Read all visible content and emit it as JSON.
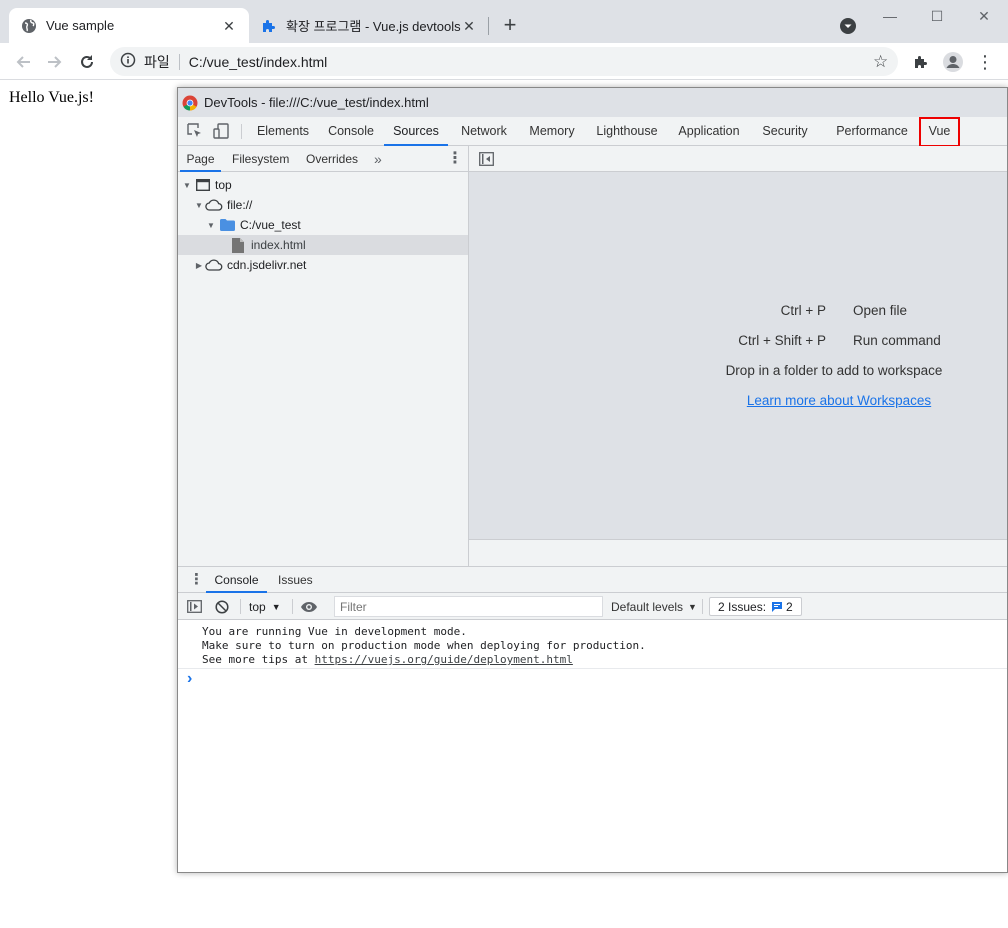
{
  "browser": {
    "tabs": [
      {
        "title": "Vue sample",
        "active": true,
        "icon": "globe-icon"
      },
      {
        "title": "확장 프로그램 - Vue.js devtools",
        "active": false,
        "icon": "puzzle-icon"
      }
    ],
    "new_tab": "+",
    "omnibox": {
      "protocol_label": "파일",
      "url": "C:/vue_test/index.html"
    }
  },
  "page": {
    "body_text": "Hello Vue.js!"
  },
  "devtools": {
    "title": "DevTools - file:///C:/vue_test/index.html",
    "tabs": [
      "Elements",
      "Console",
      "Sources",
      "Network",
      "Memory",
      "Lighthouse",
      "Application",
      "Security",
      "Performance",
      "Vue"
    ],
    "selected_tab": "Sources",
    "highlighted_tab": "Vue",
    "sources": {
      "subtabs": [
        "Page",
        "Filesystem",
        "Overrides"
      ],
      "more": "»",
      "tree": [
        {
          "label": "top",
          "icon": "frame-icon"
        },
        {
          "label": "file://",
          "icon": "cloud-icon"
        },
        {
          "label": "C:/vue_test",
          "icon": "folder-icon"
        },
        {
          "label": "index.html",
          "icon": "file-icon"
        },
        {
          "label": "cdn.jsdelivr.net",
          "icon": "cloud-icon"
        }
      ],
      "shortcuts": [
        {
          "key": "Ctrl + P",
          "label": "Open file"
        },
        {
          "key": "Ctrl + Shift + P",
          "label": "Run command"
        }
      ],
      "workspace_hint": "Drop in a folder to add to workspace",
      "workspace_link": "Learn more about Workspaces"
    },
    "drawer": {
      "tabs": [
        "Console",
        "Issues"
      ],
      "context": "top",
      "filter_placeholder": "Filter",
      "levels": "Default levels",
      "issues_label": "2 Issues:",
      "issues_count": "2",
      "messages": [
        "You are running Vue in development mode.",
        "Make sure to turn on production mode when deploying for production.",
        "See more tips at "
      ],
      "link": "https://vuejs.org/guide/deployment.html",
      "prompt": "›"
    }
  },
  "colors": {
    "accent": "#1a73e8",
    "highlight": "#ee0000"
  }
}
